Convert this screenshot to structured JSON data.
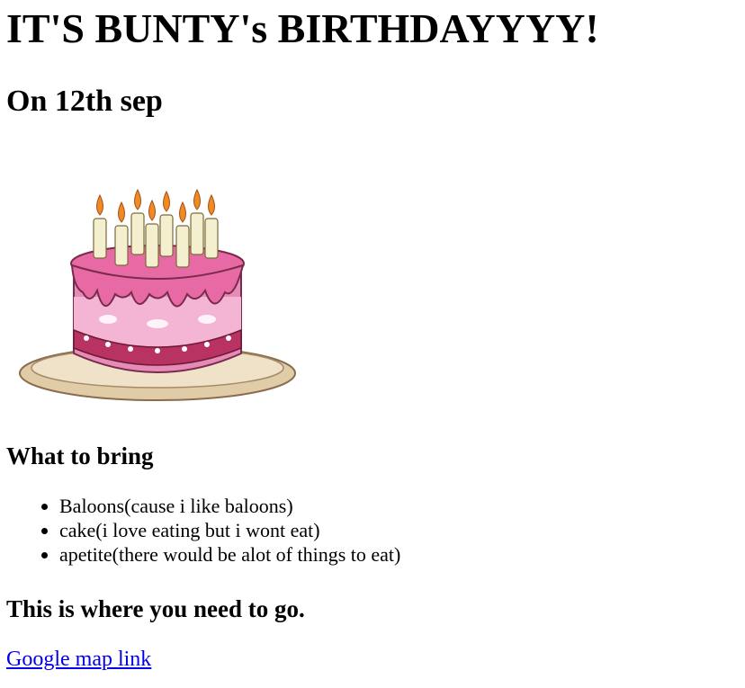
{
  "page": {
    "title": "IT'S BUNTY's BIRTHDAYYYY!",
    "subtitle": "On 12th sep"
  },
  "cake_image": {
    "icon": "birthday-cake-icon",
    "colors": {
      "frosting": "#e86aa5",
      "frosting_dark": "#c8407f",
      "cake_light": "#f6b9d6",
      "band": "#b83262",
      "candle": "#f4f0cf",
      "flame": "#f08a24",
      "plate": "#e9d8b8",
      "plate_edge": "#8a6d4f"
    }
  },
  "bring": {
    "heading": "What to bring",
    "items": [
      "Baloons(cause i like baloons)",
      "cake(i love eating but i wont eat)",
      "apetite(there would be alot of things to eat)"
    ]
  },
  "location": {
    "heading": "This is where you need to go.",
    "link_text": "Google map link",
    "link_color": "#0000ee"
  }
}
